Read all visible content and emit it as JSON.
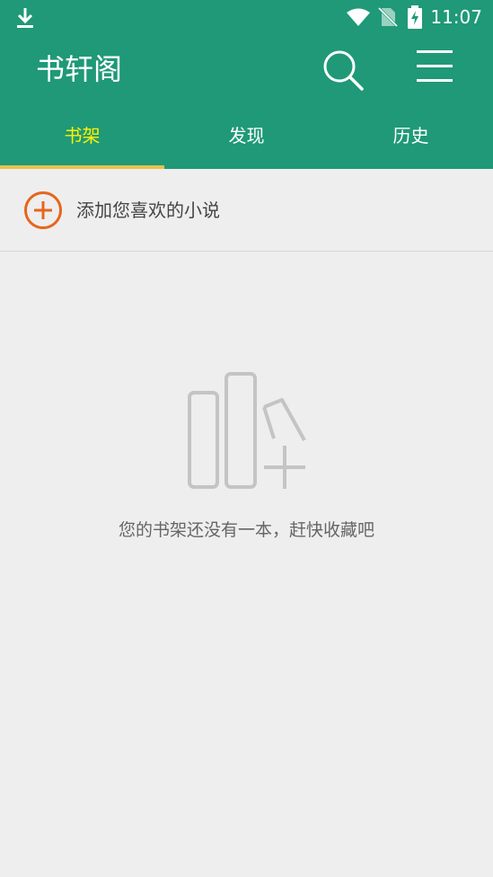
{
  "status_bar": {
    "time": "11:07",
    "icons": [
      "download-icon",
      "wifi-icon",
      "no-sim-icon",
      "battery-charging-icon"
    ]
  },
  "app_bar": {
    "title": "书轩阁",
    "icons": [
      "search-icon",
      "menu-icon"
    ]
  },
  "tabs": [
    {
      "label": "书架",
      "active": true
    },
    {
      "label": "发现",
      "active": false
    },
    {
      "label": "历史",
      "active": false
    }
  ],
  "add_row": {
    "label": "添加您喜欢的小说",
    "icon": "add-circle-icon"
  },
  "empty_state": {
    "icon": "empty-bookshelf-icon",
    "message": "您的书架还没有一本，赶快收藏吧"
  },
  "colors": {
    "primary": "#1f9977",
    "active_tab_text": "#fff200",
    "tab_indicator": "#e8c24a",
    "add_icon": "#e5661c",
    "background": "#eeeeee"
  }
}
